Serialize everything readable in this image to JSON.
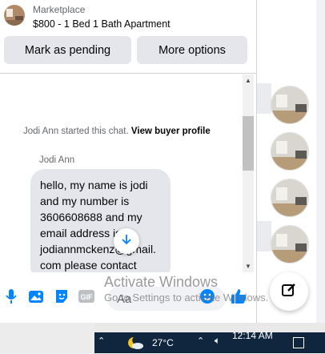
{
  "header": {
    "source": "Marketplace",
    "listing": "$800 - 1 Bed 1 Bath Apartment",
    "mark_pending_label": "Mark as pending",
    "more_options_label": "More options"
  },
  "conversation": {
    "system_note_prefix": "Jodi Ann started this chat.",
    "system_note_link": "View buyer profile",
    "sender": "Jodi Ann",
    "message_lines": [
      "hello, my name is jodi",
      "and my number is",
      "3606608688 and my",
      "email address is",
      "jodiannmckenz@gmail.",
      "com please contact"
    ]
  },
  "composer": {
    "placeholder": "Aa",
    "icons": [
      "microphone-icon",
      "photo-icon",
      "sticker-icon",
      "gif-icon",
      "emoji-icon",
      "thumbs-up-icon"
    ]
  },
  "watermark": {
    "title": "Activate Windows",
    "subtitle": "Go to Settings to activate Windows."
  },
  "taskbar": {
    "temperature": "27°C",
    "time": "12:14 AM"
  },
  "colors": {
    "accent": "#0084ff",
    "button_bg": "#e4e6eb",
    "bubble_bg": "#e4e6eb",
    "taskbar_dark": "#10263f"
  }
}
